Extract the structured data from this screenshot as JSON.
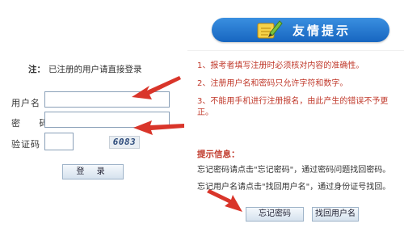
{
  "login": {
    "note_prefix": "注：",
    "note_text": "已注册的用户请直接登录",
    "username_label": "用户名",
    "password_label": "密  码",
    "captcha_label": "验证码",
    "captcha_code": "6083",
    "login_button": "登 录"
  },
  "tips": {
    "title": "友情提示",
    "items": [
      "1、报考者填写注册时必须核对内容的准确性。",
      "2、注册用户名和密码只允许字符和数字。",
      "3、不能用手机进行注册报名，由此产生的错误不予更",
      "正。"
    ],
    "hint_title": "提示信息：",
    "hint_lines": [
      "忘记密码请点击\"忘记密码\"，通过密码问题找回密码。",
      "忘记用户名请点击\"找回用户名\"，通过身份证号找回。"
    ],
    "forgot_password_button": "忘记密码",
    "forgot_username_button": "找回用户名"
  },
  "colors": {
    "banner": "#1f74d0",
    "tip_text": "#c0392b",
    "arrow": "#d9352a"
  }
}
